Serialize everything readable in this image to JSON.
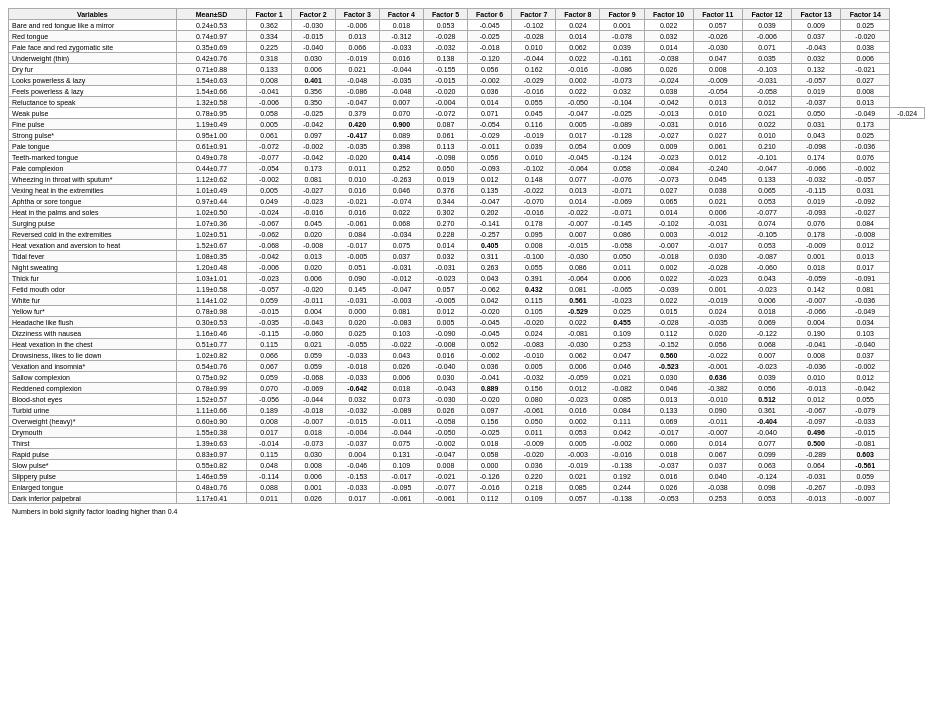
{
  "table": {
    "headers": [
      "Variables",
      "Mean±SD",
      "Factor 1",
      "Factor 2",
      "Factor 3",
      "Factor 4",
      "Factor 5",
      "Factor 6",
      "Factor 7",
      "Factor 8",
      "Factor 9",
      "Factor 10",
      "Factor 11",
      "Factor 12",
      "Factor 13",
      "Factor 14"
    ],
    "rows": [
      [
        "Bare and red tongue like a mirror",
        "0.24±0.53",
        "0.362",
        "-0.030",
        "-0.006",
        "0.018",
        "0.053",
        "-0.045",
        "-0.102",
        "0.024",
        "0.001",
        "0.022",
        "0.057",
        "0.039",
        "0.009",
        "0.025"
      ],
      [
        "Red tongue",
        "0.74±0.97",
        "0.334",
        "-0.015",
        "0.013",
        "-0.312",
        "-0.028",
        "-0.025",
        "-0.028",
        "0.014",
        "-0.078",
        "0.032",
        "-0.026",
        "-0.006",
        "0.037",
        "-0.020"
      ],
      [
        "Pale face and red zygomatic site",
        "0.35±0.69",
        "0.225",
        "-0.040",
        "0.066",
        "-0.033",
        "-0.032",
        "-0.018",
        "0.010",
        "0.062",
        "0.039",
        "0.014",
        "-0.030",
        "0.071",
        "-0.043",
        "0.038"
      ],
      [
        "Underweight (thin)",
        "0.42±0.76",
        "0.318",
        "0.030",
        "-0.019",
        "0.016",
        "0.138",
        "-0.120",
        "-0.044",
        "0.022",
        "-0.161",
        "-0.038",
        "0.047",
        "0.035",
        "0.032",
        "0.006"
      ],
      [
        "Dry fur",
        "0.71±0.88",
        "0.133",
        "0.006",
        "0.021",
        "-0.044",
        "-0.155",
        "0.056",
        "0.162",
        "-0.016",
        "-0.086",
        "0.026",
        "0.008",
        "-0.103",
        "0.132",
        "-0.021"
      ],
      [
        "Looks powerless & lazy",
        "1.54±0.63",
        "0.008",
        "0.401",
        "-0.048",
        "-0.035",
        "-0.015",
        "-0.002",
        "-0.029",
        "0.002",
        "-0.073",
        "-0.024",
        "-0.009",
        "-0.031",
        "-0.057",
        "0.027"
      ],
      [
        "Feels powerless & lazy",
        "1.54±0.66",
        "-0.041",
        "0.356",
        "-0.086",
        "-0.048",
        "-0.020",
        "0.036",
        "-0.016",
        "0.022",
        "0.032",
        "0.038",
        "-0.054",
        "-0.058",
        "0.019",
        "0.008"
      ],
      [
        "Reluctance to speak",
        "1.32±0.58",
        "-0.006",
        "0.350",
        "-0.047",
        "0.007",
        "-0.004",
        "0.014",
        "0.055",
        "-0.050",
        "-0.104",
        "-0.042",
        "0.013",
        "0.012",
        "-0.037",
        "0.013"
      ],
      [
        "Weak pulse",
        "0.78±0.95",
        "0.058",
        "-0.025",
        "0.379",
        "0.070",
        "-0.072",
        "0.071",
        "0.045",
        "-0.047",
        "-0.025",
        "-0.013",
        "0.010",
        "0.021",
        "0.050",
        "-0.049",
        "-0.024"
      ],
      [
        "Fine pulse",
        "1.19±0.49",
        "0.005",
        "-0.042",
        "0.420",
        "0.900",
        "0.087",
        "-0.054",
        "0.116",
        "0.005",
        "-0.089",
        "-0.031",
        "0.016",
        "0.022",
        "0.031",
        "0.173"
      ],
      [
        "Strong pulse*",
        "0.95±1.00",
        "0.061",
        "0.097",
        "-0.417",
        "0.089",
        "0.061",
        "-0.029",
        "-0.019",
        "0.017",
        "-0.128",
        "-0.027",
        "0.027",
        "0.010",
        "0.043",
        "0.025"
      ],
      [
        "Pale tongue",
        "0.61±0.91",
        "-0.072",
        "-0.002",
        "-0.035",
        "0.398",
        "0.113",
        "-0.011",
        "0.039",
        "0.054",
        "0.009",
        "0.009",
        "0.061",
        "0.210",
        "-0.098",
        "-0.036"
      ],
      [
        "Teeth-marked tongue",
        "0.49±0.78",
        "-0.077",
        "-0.042",
        "-0.020",
        "0.414",
        "-0.098",
        "0.056",
        "0.010",
        "-0.045",
        "-0.124",
        "-0.023",
        "0.012",
        "-0.101",
        "0.174",
        "0.076"
      ],
      [
        "Pale complexion",
        "0.44±0.77",
        "-0.054",
        "0.173",
        "0.011",
        "0.252",
        "0.050",
        "-0.093",
        "-0.102",
        "-0.064",
        "0.058",
        "-0.084",
        "-0.240",
        "-0.047",
        "-0.066",
        "-0.002"
      ],
      [
        "Wheezing in throat with sputum*",
        "1.12±0.62",
        "-0.002",
        "0.081",
        "0.010",
        "-0.263",
        "0.019",
        "0.012",
        "0.148",
        "0.077",
        "-0.076",
        "-0.073",
        "0.045",
        "0.133",
        "-0.032",
        "-0.057"
      ],
      [
        "Vexing heat in the extremities",
        "1.01±0.49",
        "0.005",
        "-0.027",
        "0.016",
        "0.046",
        "0.376",
        "0.135",
        "-0.022",
        "0.013",
        "-0.071",
        "0.027",
        "0.038",
        "0.065",
        "-0.115",
        "0.031"
      ],
      [
        "Aphtha or sore tongue",
        "0.97±0.44",
        "0.049",
        "-0.023",
        "-0.021",
        "-0.074",
        "0.344",
        "-0.047",
        "-0.070",
        "0.014",
        "-0.069",
        "0.065",
        "0.021",
        "0.053",
        "0.019",
        "-0.092"
      ],
      [
        "Heat in the palms and soles",
        "1.02±0.50",
        "-0.024",
        "-0.016",
        "0.016",
        "0.022",
        "0.302",
        "0.202",
        "-0.016",
        "-0.022",
        "-0.071",
        "0.014",
        "0.006",
        "-0.077",
        "-0.093",
        "-0.027"
      ],
      [
        "Surging pulse",
        "1.07±0.36",
        "-0.067",
        "0.045",
        "-0.061",
        "0.068",
        "0.270",
        "-0.141",
        "0.178",
        "-0.007",
        "-0.145",
        "-0.102",
        "-0.031",
        "0.074",
        "0.076",
        "0.084"
      ],
      [
        "Reversed cold in the extremities",
        "1.02±0.51",
        "-0.062",
        "0.020",
        "0.084",
        "-0.034",
        "0.228",
        "-0.257",
        "0.095",
        "0.007",
        "0.086",
        "0.003",
        "-0.012",
        "-0.105",
        "0.178",
        "-0.008"
      ],
      [
        "Heat vexation and aversion to heat",
        "1.52±0.67",
        "-0.068",
        "-0.008",
        "-0.017",
        "0.075",
        "0.014",
        "0.405",
        "0.008",
        "-0.015",
        "-0.058",
        "-0.007",
        "-0.017",
        "0.053",
        "-0.009",
        "0.012"
      ],
      [
        "Tidal fever",
        "1.08±0.35",
        "-0.042",
        "0.013",
        "-0.005",
        "0.037",
        "0.032",
        "0.311",
        "-0.100",
        "-0.030",
        "0.050",
        "-0.018",
        "0.030",
        "-0.087",
        "0.001",
        "0.013"
      ],
      [
        "Night sweating",
        "1.20±0.48",
        "-0.006",
        "0.020",
        "0.051",
        "-0.031",
        "-0.031",
        "0.263",
        "0.055",
        "0.086",
        "0.011",
        "0.002",
        "-0.028",
        "-0.060",
        "0.018",
        "0.017"
      ],
      [
        "Thick fur",
        "1.03±1.01",
        "-0.023",
        "0.006",
        "0.090",
        "-0.012",
        "-0.023",
        "0.043",
        "0.391",
        "-0.064",
        "0.006",
        "0.022",
        "-0.023",
        "0.043",
        "-0.059",
        "-0.091"
      ],
      [
        "Fetid mouth odor",
        "1.19±0.58",
        "-0.057",
        "-0.020",
        "0.145",
        "-0.047",
        "0.057",
        "-0.062",
        "0.432",
        "0.081",
        "-0.065",
        "-0.039",
        "0.001",
        "-0.023",
        "0.142",
        "0.081"
      ],
      [
        "White fur",
        "1.14±1.02",
        "0.059",
        "-0.011",
        "-0.031",
        "-0.003",
        "-0.005",
        "0.042",
        "0.115",
        "0.561",
        "-0.023",
        "0.022",
        "-0.019",
        "0.006",
        "-0.007",
        "-0.036"
      ],
      [
        "Yellow fur*",
        "0.78±0.98",
        "-0.015",
        "0.004",
        "0.000",
        "0.081",
        "0.012",
        "-0.020",
        "0.105",
        "-0.529",
        "0.025",
        "0.015",
        "0.024",
        "0.018",
        "-0.066",
        "-0.049"
      ],
      [
        "Headache like flush",
        "0.30±0.53",
        "-0.035",
        "-0.043",
        "0.020",
        "-0.083",
        "0.005",
        "-0.045",
        "-0.020",
        "0.022",
        "0.455",
        "-0.028",
        "-0.035",
        "0.069",
        "0.004",
        "0.034"
      ],
      [
        "Dizziness with nausea",
        "1.16±0.46",
        "-0.115",
        "-0.060",
        "0.025",
        "0.103",
        "-0.090",
        "-0.045",
        "0.024",
        "-0.081",
        "0.109",
        "0.112",
        "0.020",
        "-0.122",
        "0.190",
        "0.103"
      ],
      [
        "Heat vexation in the chest",
        "0.51±0.77",
        "0.115",
        "0.021",
        "-0.055",
        "-0.022",
        "-0.008",
        "0.052",
        "-0.083",
        "-0.030",
        "0.253",
        "-0.152",
        "0.056",
        "0.068",
        "-0.041",
        "-0.040"
      ],
      [
        "Drowsiness, likes to lie down",
        "1.02±0.82",
        "0.066",
        "0.059",
        "-0.033",
        "0.043",
        "0.016",
        "-0.002",
        "-0.010",
        "0.062",
        "0.047",
        "0.560",
        "-0.022",
        "0.007",
        "0.008",
        "0.037"
      ],
      [
        "Vexation and insomnia*",
        "0.54±0.76",
        "0.067",
        "0.059",
        "-0.018",
        "0.026",
        "-0.040",
        "0.036",
        "0.005",
        "0.006",
        "0.046",
        "-0.523",
        "-0.001",
        "-0.023",
        "-0.036",
        "-0.002"
      ],
      [
        "Sallow complexion",
        "0.75±0.92",
        "0.059",
        "-0.068",
        "-0.033",
        "0.006",
        "0.030",
        "-0.041",
        "-0.032",
        "-0.059",
        "0.021",
        "0.030",
        "0.636",
        "0.039",
        "0.010",
        "0.012"
      ],
      [
        "Reddened complexion",
        "0.78±0.99",
        "0.070",
        "-0.069",
        "-0.642",
        "0.018",
        "-0.043",
        "0.889",
        "0.156",
        "0.012",
        "-0.082",
        "0.046",
        "-0.382",
        "0.056",
        "-0.013",
        "-0.042"
      ],
      [
        "Blood-shot eyes",
        "1.52±0.57",
        "-0.056",
        "-0.044",
        "0.032",
        "0.073",
        "-0.030",
        "-0.020",
        "0.080",
        "-0.023",
        "0.085",
        "0.013",
        "-0.010",
        "0.512",
        "0.012",
        "0.055"
      ],
      [
        "Turbid urine",
        "1.11±0.66",
        "0.189",
        "-0.018",
        "-0.032",
        "-0.089",
        "0.026",
        "0.097",
        "-0.061",
        "0.016",
        "0.084",
        "0.133",
        "0.090",
        "0.361",
        "-0.067",
        "-0.079"
      ],
      [
        "Overweight (heavy)*",
        "0.60±0.90",
        "0.008",
        "-0.007",
        "-0.015",
        "-0.011",
        "-0.058",
        "0.156",
        "0.050",
        "0.002",
        "0.111",
        "0.069",
        "-0.011",
        "-0.404",
        "-0.097",
        "-0.033"
      ],
      [
        "Drymouth",
        "1.55±0.38",
        "0.017",
        "0.018",
        "-0.004",
        "-0.044",
        "-0.050",
        "-0.025",
        "0.011",
        "0.053",
        "0.042",
        "-0.017",
        "-0.007",
        "-0.040",
        "0.496",
        "-0.015"
      ],
      [
        "Thirst",
        "1.39±0.63",
        "-0.014",
        "-0.073",
        "-0.037",
        "0.075",
        "-0.002",
        "0.018",
        "-0.009",
        "0.005",
        "-0.002",
        "0.060",
        "0.014",
        "0.077",
        "0.500",
        "-0.081"
      ],
      [
        "Rapid pulse",
        "0.83±0.97",
        "0.115",
        "0.030",
        "0.004",
        "0.131",
        "-0.047",
        "0.058",
        "-0.020",
        "-0.003",
        "-0.016",
        "0.018",
        "0.067",
        "0.099",
        "-0.289",
        "0.603"
      ],
      [
        "Slow pulse*",
        "0.55±0.82",
        "0.048",
        "0.008",
        "-0.046",
        "0.109",
        "0.008",
        "0.000",
        "0.036",
        "-0.019",
        "-0.138",
        "-0.037",
        "0.037",
        "0.063",
        "0.064",
        "-0.561"
      ],
      [
        "Slippery pulse",
        "1.46±0.59",
        "-0.114",
        "0.006",
        "-0.153",
        "-0.017",
        "-0.021",
        "-0.126",
        "0.220",
        "0.021",
        "0.192",
        "0.016",
        "0.040",
        "-0.124",
        "-0.031",
        "0.059"
      ],
      [
        "Enlarged tongue",
        "0.48±0.76",
        "0.088",
        "0.001",
        "-0.033",
        "-0.095",
        "-0.077",
        "-0.016",
        "0.218",
        "0.085",
        "0.244",
        "0.026",
        "-0.038",
        "0.098",
        "-0.267",
        "-0.093"
      ],
      [
        "Dark inferior palpebral",
        "1.17±0.41",
        "0.011",
        "0.026",
        "0.017",
        "-0.061",
        "-0.061",
        "0.112",
        "0.109",
        "0.057",
        "-0.138",
        "-0.053",
        "0.253",
        "0.053",
        "-0.013",
        "-0.007"
      ]
    ],
    "footnote": "Numbers in bold signify factor loading higher than 0.4"
  }
}
